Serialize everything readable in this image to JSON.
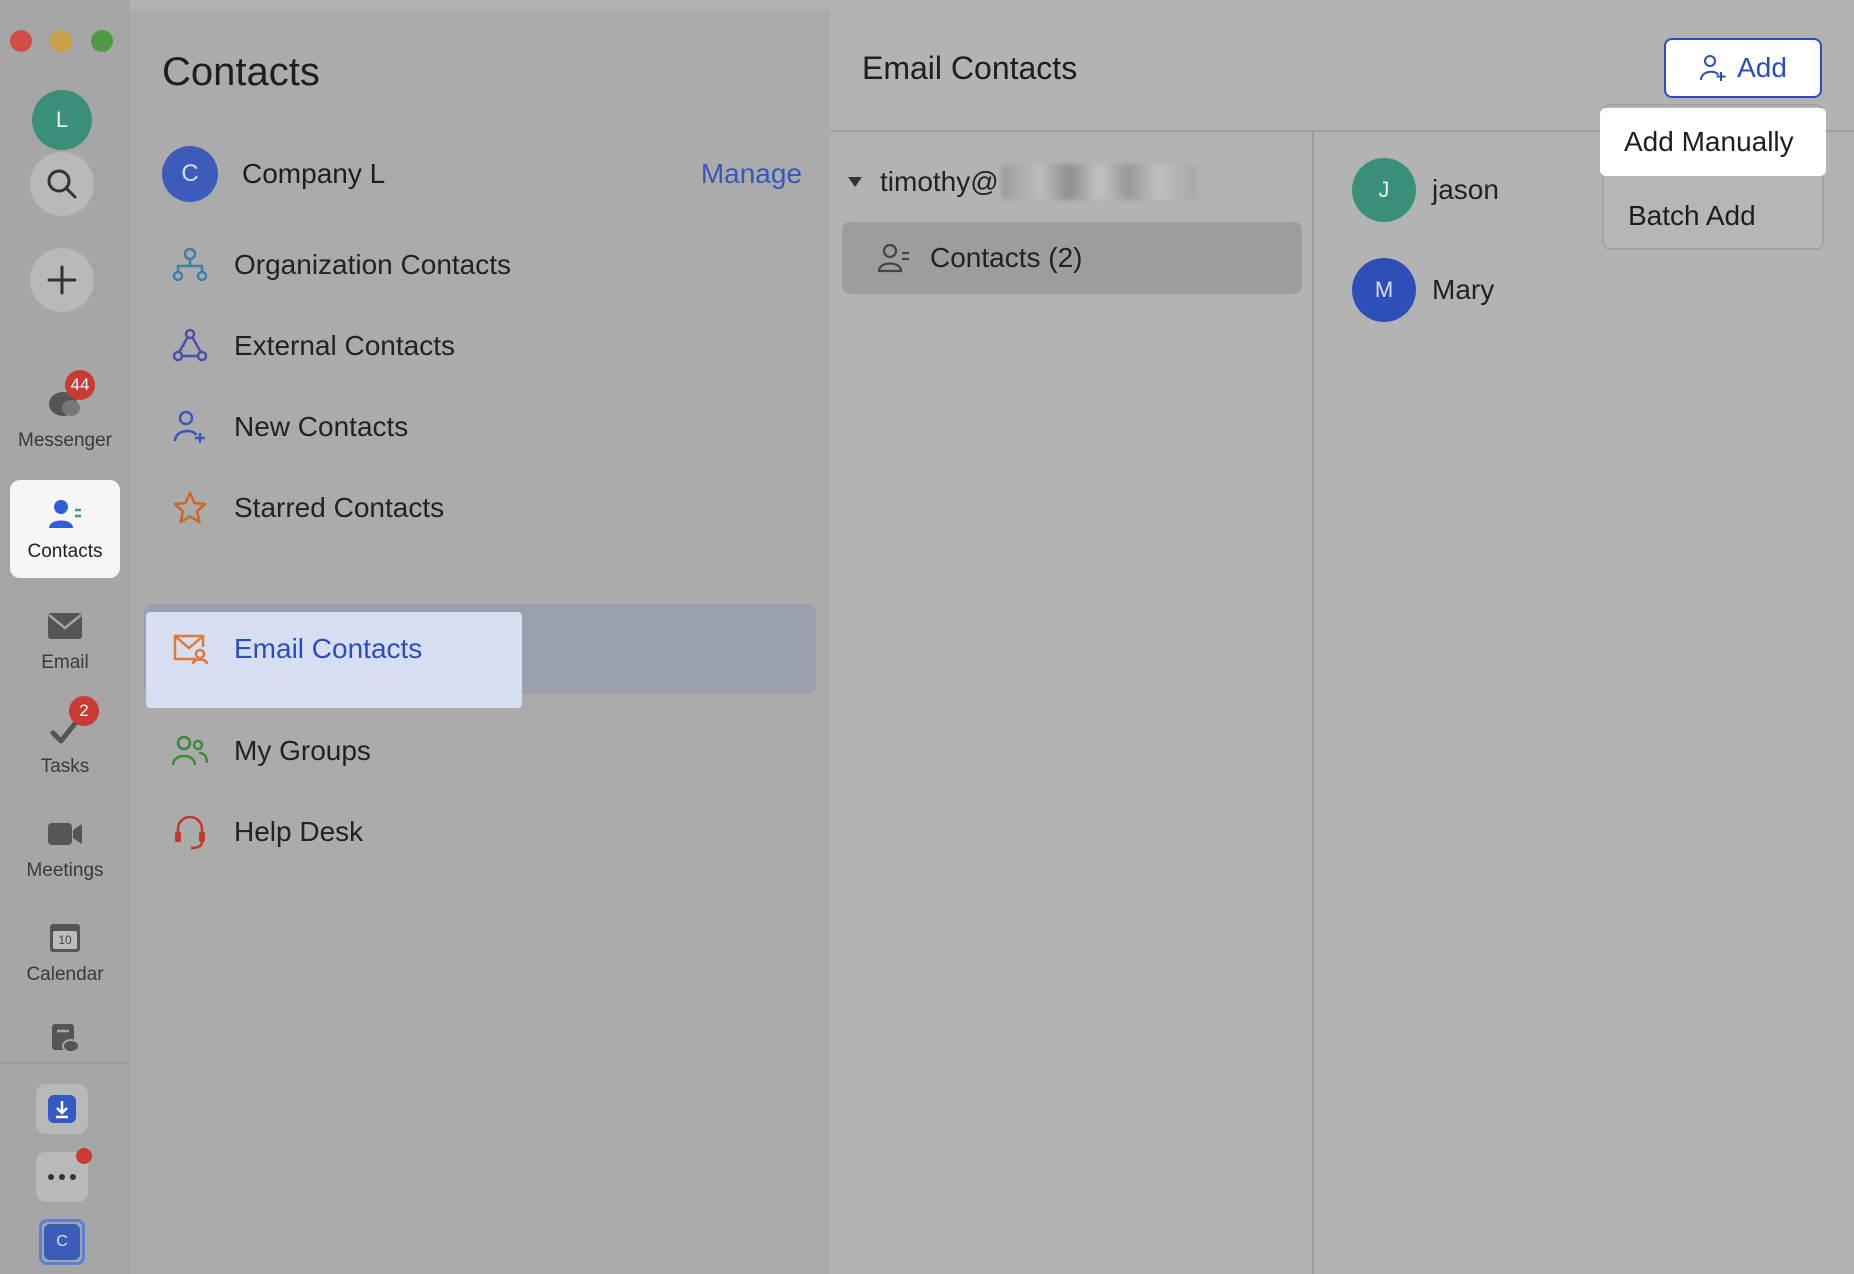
{
  "rail": {
    "avatar_letter": "L",
    "items": [
      {
        "label": "Messenger",
        "badge": "44"
      },
      {
        "label": "Contacts"
      },
      {
        "label": "Email"
      },
      {
        "label": "Tasks",
        "badge": "2"
      },
      {
        "label": "Meetings"
      },
      {
        "label": "Calendar",
        "icon_text": "10"
      }
    ],
    "bottom_avatar_letter": "C"
  },
  "nav": {
    "title": "Contacts",
    "company": {
      "letter": "C",
      "name": "Company L",
      "manage_label": "Manage"
    },
    "items": [
      {
        "label": "Organization Contacts"
      },
      {
        "label": "External Contacts"
      },
      {
        "label": "New Contacts"
      },
      {
        "label": "Starred Contacts"
      },
      {
        "label": "Email Contacts"
      },
      {
        "label": "My Groups"
      },
      {
        "label": "Help Desk"
      }
    ]
  },
  "content": {
    "title": "Email Contacts",
    "add_label": "Add",
    "dropdown": [
      "Add Manually",
      "Batch Add"
    ],
    "account_prefix": "timothy@",
    "group_label": "Contacts (2)",
    "people": [
      {
        "letter": "J",
        "name": "jason"
      },
      {
        "letter": "M",
        "name": "Mary"
      }
    ]
  },
  "colors": {
    "accent": "#2b4dbf",
    "badge": "#c93a33",
    "selected_chip": "#d6dff1"
  }
}
